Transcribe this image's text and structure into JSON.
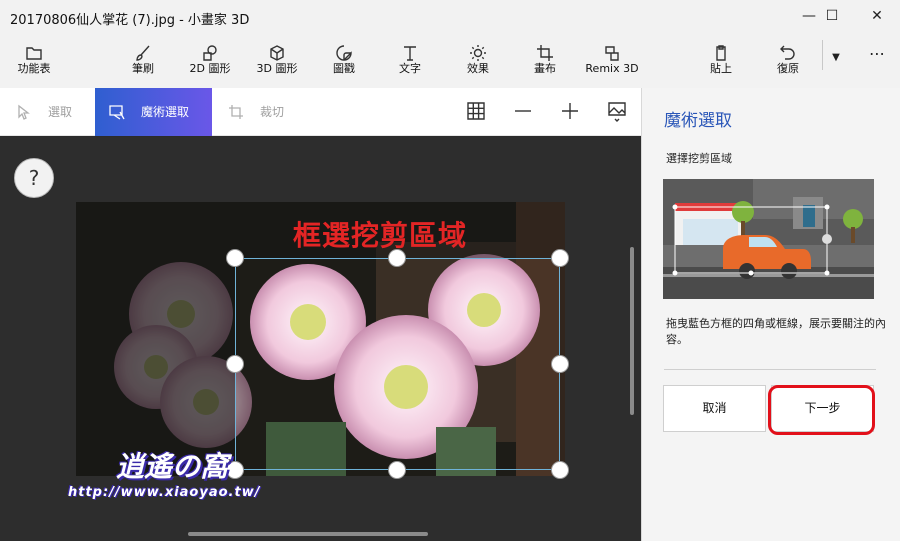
{
  "window": {
    "title": "20170806仙人掌花 (7).jpg - 小畫家 3D",
    "buttons": {
      "minimize": "—",
      "maximize": "☐",
      "close": "✕"
    }
  },
  "toolbar": {
    "menu": "功能表",
    "brushes": "筆刷",
    "shapes2d": "2D 圖形",
    "shapes3d": "3D 圖形",
    "stickers": "圖戳",
    "text": "文字",
    "effects": "效果",
    "canvas": "畫布",
    "remix": "Remix 3D",
    "paste": "貼上",
    "undo": "復原",
    "more": "⋯"
  },
  "subbar": {
    "select": "選取",
    "magic_select": "魔術選取",
    "crop": "裁切"
  },
  "canvas": {
    "help": "?",
    "headline": "框選挖剪區域",
    "watermark_name": "逍遙の窩",
    "watermark_url": "http://www.xiaoyao.tw/"
  },
  "panel": {
    "title": "魔術選取",
    "subtitle": "選擇挖剪區域",
    "description": "拖曳藍色方框的四角或框線，展示要關注的內容。",
    "cancel": "取消",
    "next": "下一步"
  },
  "colors": {
    "accent_blue": "#2a56b8",
    "active_gradient_start": "#2f5fd0",
    "active_gradient_end": "#6a57e8",
    "highlight_red": "#e2101a",
    "headline_red": "#e32525"
  }
}
